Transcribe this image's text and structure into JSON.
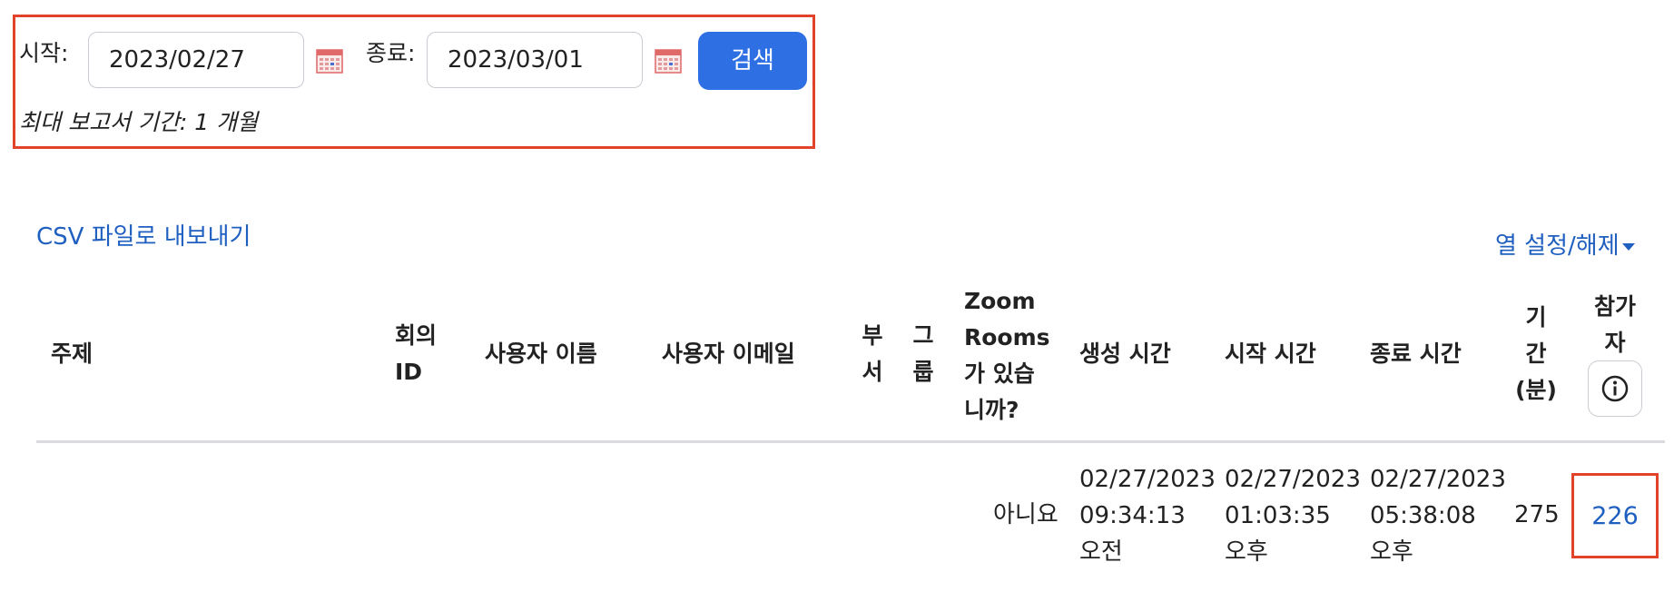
{
  "filter": {
    "start_label": "시작:",
    "start_value": "2023/02/27",
    "end_label": "종료:",
    "end_value": "2023/03/01",
    "search_label": "검색",
    "note": "최대 보고서 기간: 1 개월"
  },
  "toolbar": {
    "csv_export": "CSV 파일로 내보내기",
    "column_toggle": "열 설정/해제"
  },
  "table": {
    "headers": {
      "topic": "주제",
      "meeting_id_1": "회의",
      "meeting_id_2": "ID",
      "user_name": "사용자 이름",
      "user_email": "사용자 이메일",
      "dept_1": "부",
      "dept_2": "서",
      "group_1": "그",
      "group_2": "룹",
      "zoom_rooms_1": "Zoom",
      "zoom_rooms_2": "Rooms",
      "zoom_rooms_3": "가 있습",
      "zoom_rooms_4": "니까?",
      "created": "생성 시간",
      "start": "시작 시간",
      "end": "종료 시간",
      "duration_1": "기",
      "duration_2": "간",
      "duration_3": "(분)",
      "participants_1": "참가",
      "participants_2": "자"
    },
    "row": {
      "zoom_rooms": "아니요",
      "created_1": "02/27/2023",
      "created_2": "09:34:13",
      "created_3": "오전",
      "start_1": "02/27/2023",
      "start_2": "01:03:35",
      "start_3": "오후",
      "end_1": "02/27/2023",
      "end_2": "05:38:08",
      "end_3": "오후",
      "duration": "275",
      "participants": "226"
    }
  },
  "icons": {
    "calendar": "calendar-icon",
    "info": "info-icon"
  },
  "colors": {
    "accent": "#2f6fe4",
    "link": "#1f5fbf",
    "highlight": "#e0432a"
  }
}
